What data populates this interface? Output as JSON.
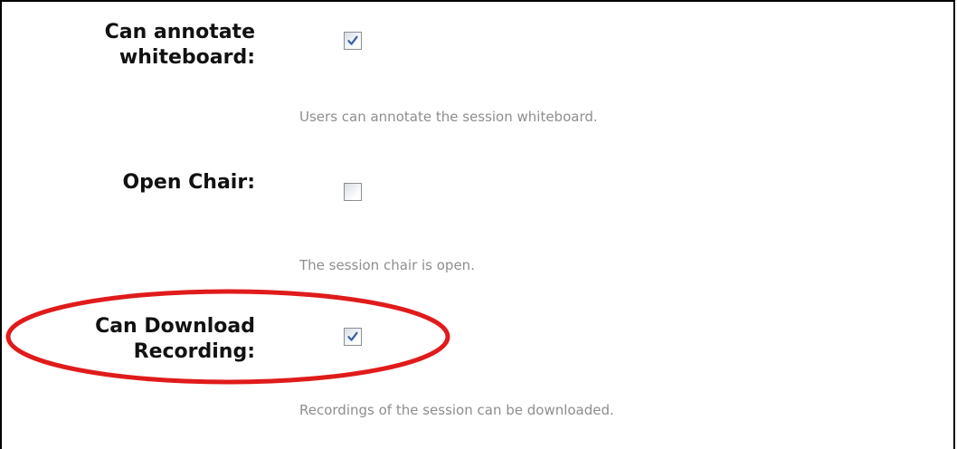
{
  "settings": [
    {
      "label_line1": "Can annotate",
      "label_line2": "whiteboard:",
      "checked": true,
      "description": "Users can annotate the session whiteboard."
    },
    {
      "label_line1": "Open Chair:",
      "label_line2": "",
      "checked": false,
      "description": "The session chair is open."
    },
    {
      "label_line1": "Can Download",
      "label_line2": "Recording:",
      "checked": true,
      "description": "Recordings of the session can be downloaded."
    }
  ],
  "colors": {
    "highlight": "#e01b1b",
    "hint_text": "#8e8e8e",
    "check_mark": "#3a5fae"
  }
}
